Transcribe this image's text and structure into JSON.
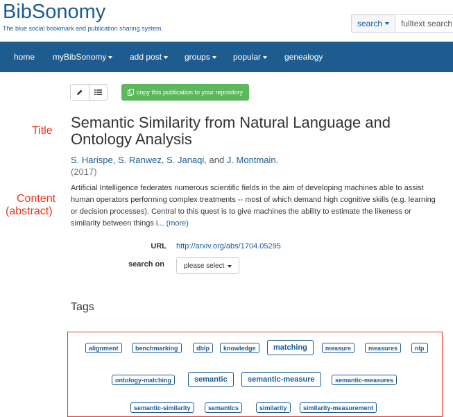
{
  "header": {
    "logo": "BibSonomy",
    "tagline": "The blue social bookmark and publication sharing system."
  },
  "search": {
    "mode_label": "search",
    "placeholder": "fulltext search"
  },
  "nav": {
    "items": [
      {
        "label": "home",
        "dropdown": false
      },
      {
        "label": "myBibSonomy",
        "dropdown": true
      },
      {
        "label": "add post",
        "dropdown": true
      },
      {
        "label": "groups",
        "dropdown": true
      },
      {
        "label": "popular",
        "dropdown": true
      },
      {
        "label": "genealogy",
        "dropdown": false
      }
    ]
  },
  "toolbar": {
    "copy_label": "copy this publication to your repository",
    "icons": [
      "pencil-icon",
      "list-icon",
      "copy-icon"
    ]
  },
  "annotations": {
    "title": "Title",
    "content_line1": "Content",
    "content_line2": "(abstract)"
  },
  "publication": {
    "title": "Semantic Similarity from Natural Language and Ontology Analysis",
    "authors": [
      "S. Harispe",
      "S. Ranwez",
      "S. Janaqi",
      "J. Montmain"
    ],
    "author_sep_1": ",",
    "author_sep_2": ",",
    "author_sep_3": ", and",
    "author_end": ".",
    "year": "(2017)",
    "abstract": "Artificial Intelligence federates numerous scientific fields in the aim of developing machines able to assist human operators performing complex treatments -- most of which demand high cognitive skills (e.g. learning or decision processes). Central to this quest is to give machines the ability to estimate the likeness or similarity between things i...",
    "more_label": "(more)"
  },
  "meta": {
    "url_label": "URL",
    "url_value": "http://arxiv.org/abs/1704.05295",
    "search_label": "search on",
    "search_select": "please select"
  },
  "tags": {
    "heading": "Tags",
    "items": [
      {
        "label": "alignment",
        "size": "small"
      },
      {
        "label": "benchmarking",
        "size": "small"
      },
      {
        "label": "dblp",
        "size": "small"
      },
      {
        "label": "knowledge",
        "size": "small"
      },
      {
        "label": "matching",
        "size": "large"
      },
      {
        "label": "measure",
        "size": "small"
      },
      {
        "label": "measures",
        "size": "small"
      },
      {
        "label": "nlp",
        "size": "small"
      },
      {
        "label": "ontology-matching",
        "size": "small"
      },
      {
        "label": "semantic",
        "size": "large"
      },
      {
        "label": "semantic-measure",
        "size": "large"
      },
      {
        "label": "semantic-measures",
        "size": "small"
      },
      {
        "label": "semantic-similarity",
        "size": "small"
      },
      {
        "label": "semantics",
        "size": "small"
      },
      {
        "label": "similarity",
        "size": "small"
      },
      {
        "label": "similarity-measurement",
        "size": "small"
      }
    ]
  },
  "colors": {
    "brand": "#1c5b93",
    "navbar": "#1e5c90",
    "copy_button": "#5cb85c",
    "annotation": "#e8321f"
  }
}
